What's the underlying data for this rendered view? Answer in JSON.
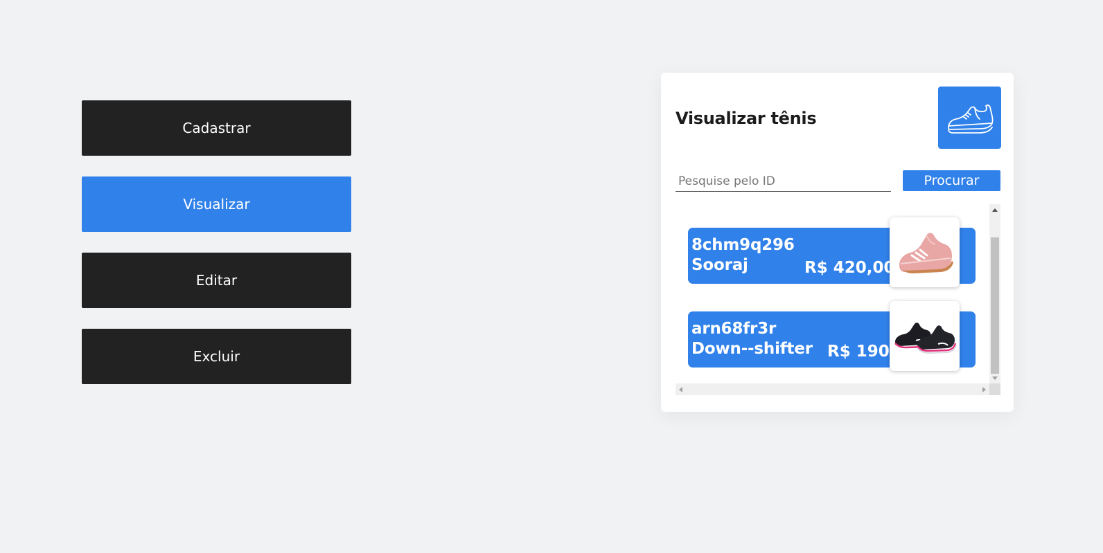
{
  "menu": {
    "items": [
      {
        "label": "Cadastrar",
        "active": false
      },
      {
        "label": "Visualizar",
        "active": true
      },
      {
        "label": "Editar",
        "active": false
      },
      {
        "label": "Excluir",
        "active": false
      }
    ]
  },
  "panel": {
    "title": "Visualizar tênis",
    "icon": "sneaker-icon",
    "search": {
      "placeholder": "Pesquise pelo ID",
      "value": "",
      "button_label": "Procurar"
    },
    "items": [
      {
        "id": "8chm9q296",
        "name": "Sooraj",
        "price": "R$ 420,00",
        "image": "pink-sneaker-image"
      },
      {
        "id": "arn68fr3r",
        "name": "Down--shifter",
        "price": "R$ 190",
        "image": "black-sneaker-pair-image"
      }
    ]
  },
  "colors": {
    "accent": "#3081ea",
    "dark_button": "#222222",
    "background": "#f1f2f4"
  }
}
